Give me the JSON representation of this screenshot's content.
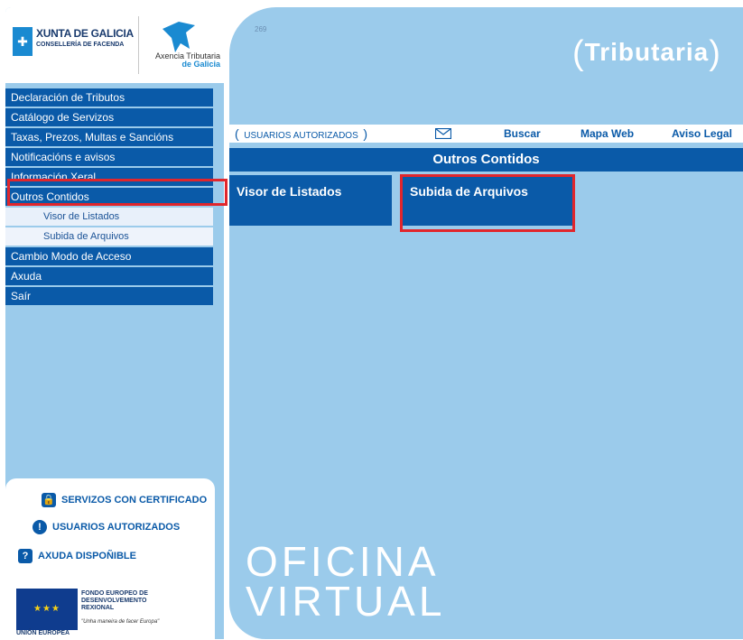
{
  "header": {
    "xunta_title": "XUNTA DE GALICIA",
    "xunta_subtitle": "CONSELLERÍA DE FACENDA",
    "atriga_name": "Axencia Tributaria",
    "atriga_galicia": "de Galicia",
    "page_number": "269",
    "brand": "Tributaria"
  },
  "menu": {
    "items": [
      {
        "label": "Declaración de Tributos"
      },
      {
        "label": "Catálogo de Servizos"
      },
      {
        "label": "Taxas, Prezos, Multas e Sancións"
      },
      {
        "label": "Notificacións e avisos"
      },
      {
        "label": "Información Xeral"
      },
      {
        "label": "Outros Contidos"
      },
      {
        "label": "Visor de Listados"
      },
      {
        "label": "Subida de Arquivos"
      },
      {
        "label": "Cambio Modo de Acceso"
      },
      {
        "label": "Axuda"
      },
      {
        "label": "Saír"
      }
    ]
  },
  "sidebar_bottom": {
    "certificado": "SERVIZOS CON CERTIFICADO",
    "usuarios": "USUARIOS AUTORIZADOS",
    "axuda": "AXUDA DISPOÑIBLE",
    "eu_text_1": "FONDO EUROPEO DE",
    "eu_text_2": "DESENVOLVEMENTO",
    "eu_text_3": "REXIONAL",
    "eu_motto": "\"Unha maneira de facer Europa\"",
    "eu_label": "UNIÓN EUROPEA"
  },
  "topnav": {
    "users": "USUARIOS AUTORIZADOS",
    "buscar": "Buscar",
    "mapa": "Mapa Web",
    "aviso": "Aviso Legal"
  },
  "section": {
    "title": "Outros Contidos",
    "tiles": [
      "Visor de Listados",
      "Subida de Arquivos"
    ]
  },
  "footer": {
    "line1": "OFICINA",
    "line2": "VIRTUAL"
  },
  "colors": {
    "accent": "#0a5aa8",
    "background": "#9bcbeb",
    "highlight": "#e1262c"
  }
}
